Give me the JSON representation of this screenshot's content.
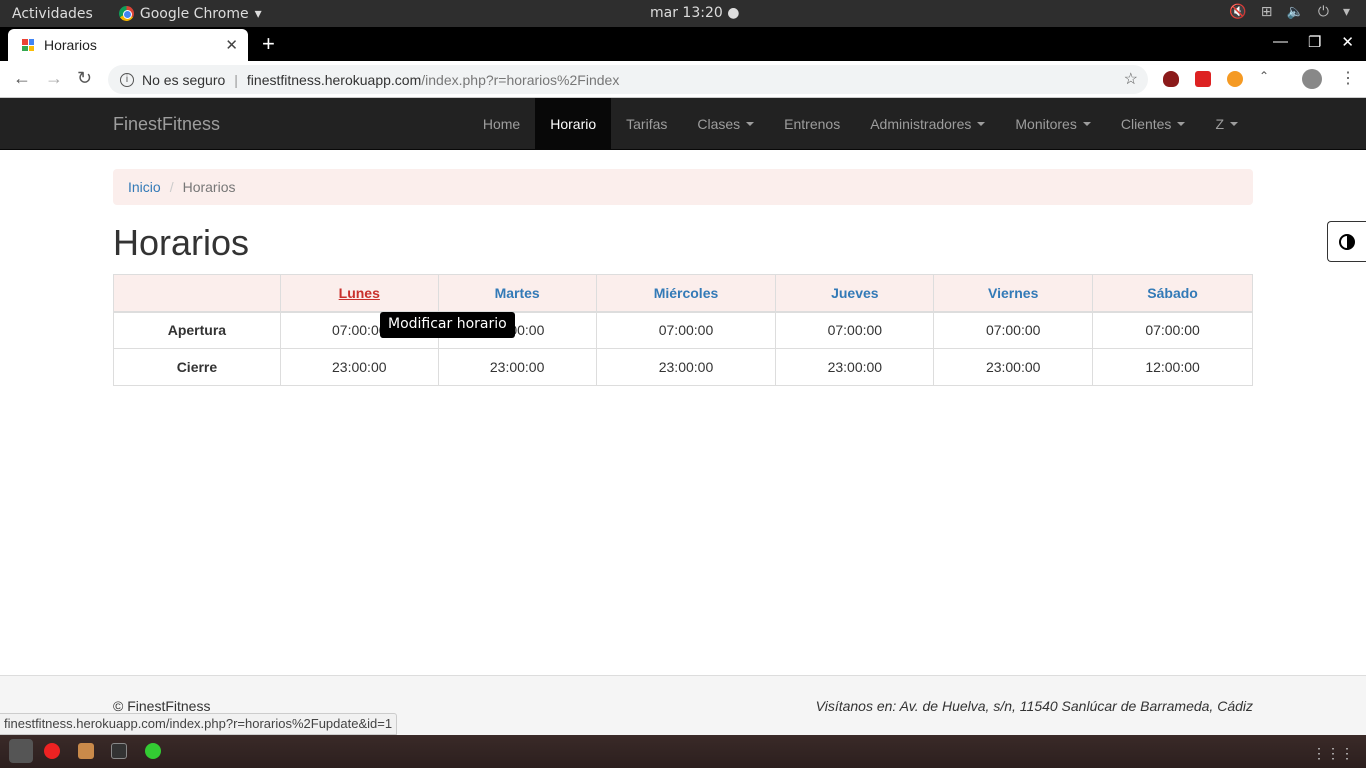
{
  "os": {
    "activities": "Actividades",
    "app_name": "Google Chrome",
    "clock": "mar 13:20"
  },
  "browser": {
    "tab_title": "Horarios",
    "url_security": "No es seguro",
    "url_host": "finestfitness.herokuapp.com",
    "url_path": "/index.php?r=horarios%2Findex",
    "status_url": "finestfitness.herokuapp.com/index.php?r=horarios%2Fupdate&id=1"
  },
  "site": {
    "brand": "FinestFitness",
    "nav": [
      {
        "label": "Home"
      },
      {
        "label": "Horario"
      },
      {
        "label": "Tarifas"
      },
      {
        "label": "Clases"
      },
      {
        "label": "Entrenos"
      },
      {
        "label": "Administradores"
      },
      {
        "label": "Monitores"
      },
      {
        "label": "Clientes"
      },
      {
        "label": "Z"
      }
    ]
  },
  "breadcrumb": {
    "home": "Inicio",
    "current": "Horarios"
  },
  "page_title": "Horarios",
  "table": {
    "days": [
      "Lunes",
      "Martes",
      "Miércoles",
      "Jueves",
      "Viernes",
      "Sábado"
    ],
    "rows": [
      {
        "label": "Apertura",
        "values": [
          "07:00:00",
          "07:00:00",
          "07:00:00",
          "07:00:00",
          "07:00:00",
          "07:00:00"
        ]
      },
      {
        "label": "Cierre",
        "values": [
          "23:00:00",
          "23:00:00",
          "23:00:00",
          "23:00:00",
          "23:00:00",
          "12:00:00"
        ]
      }
    ]
  },
  "tooltip": "Modificar horario",
  "footer": {
    "copyright": "© FinestFitness",
    "address": "Visítanos en: Av. de Huelva, s/n, 11540 Sanlúcar de Barrameda, Cádiz"
  }
}
